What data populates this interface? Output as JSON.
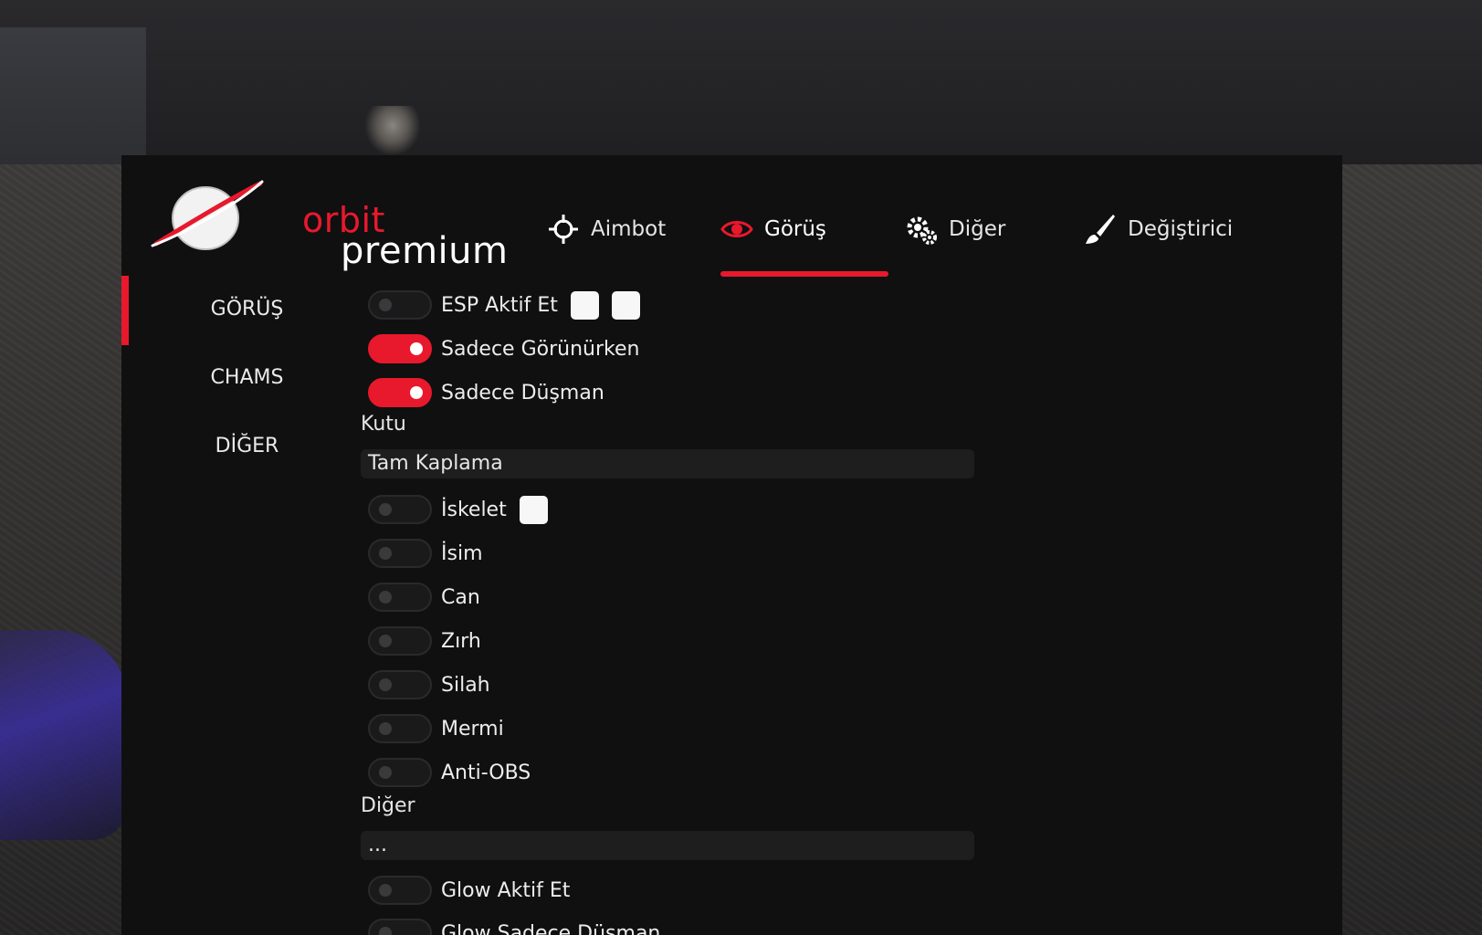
{
  "brand": {
    "line1": "orbit",
    "line2": "premium",
    "accent": "#e8192c"
  },
  "tabs": [
    {
      "label": "Aimbot",
      "icon": "crosshair-icon"
    },
    {
      "label": "Görüş",
      "icon": "eye-icon",
      "active": true
    },
    {
      "label": "Diğer",
      "icon": "gears-icon"
    },
    {
      "label": "Değiştirici",
      "icon": "paintbrush-icon"
    }
  ],
  "sidebar": {
    "items": [
      {
        "label": "GÖRÜŞ",
        "active": true
      },
      {
        "label": "CHAMS"
      },
      {
        "label": "DİĞER"
      }
    ]
  },
  "settings": {
    "esp_enable": {
      "label": "ESP Aktif Et",
      "on": false
    },
    "only_visible": {
      "label": "Sadece Görünürken",
      "on": true
    },
    "only_enemy": {
      "label": "Sadece Düşman",
      "on": true
    },
    "box_label": "Kutu",
    "box_value": "Tam Kaplama",
    "skeleton": {
      "label": "İskelet",
      "on": false
    },
    "name": {
      "label": "İsim",
      "on": false
    },
    "health": {
      "label": "Can",
      "on": false
    },
    "armor": {
      "label": "Zırh",
      "on": false
    },
    "weapon": {
      "label": "Silah",
      "on": false
    },
    "ammo": {
      "label": "Mermi",
      "on": false
    },
    "anti_obs": {
      "label": "Anti-OBS",
      "on": false
    },
    "other_label": "Diğer",
    "other_value": "...",
    "glow_enable": {
      "label": "Glow Aktif Et",
      "on": false
    },
    "glow_only_enemy": {
      "label": "Glow Sadece Düşman",
      "on": false
    }
  }
}
